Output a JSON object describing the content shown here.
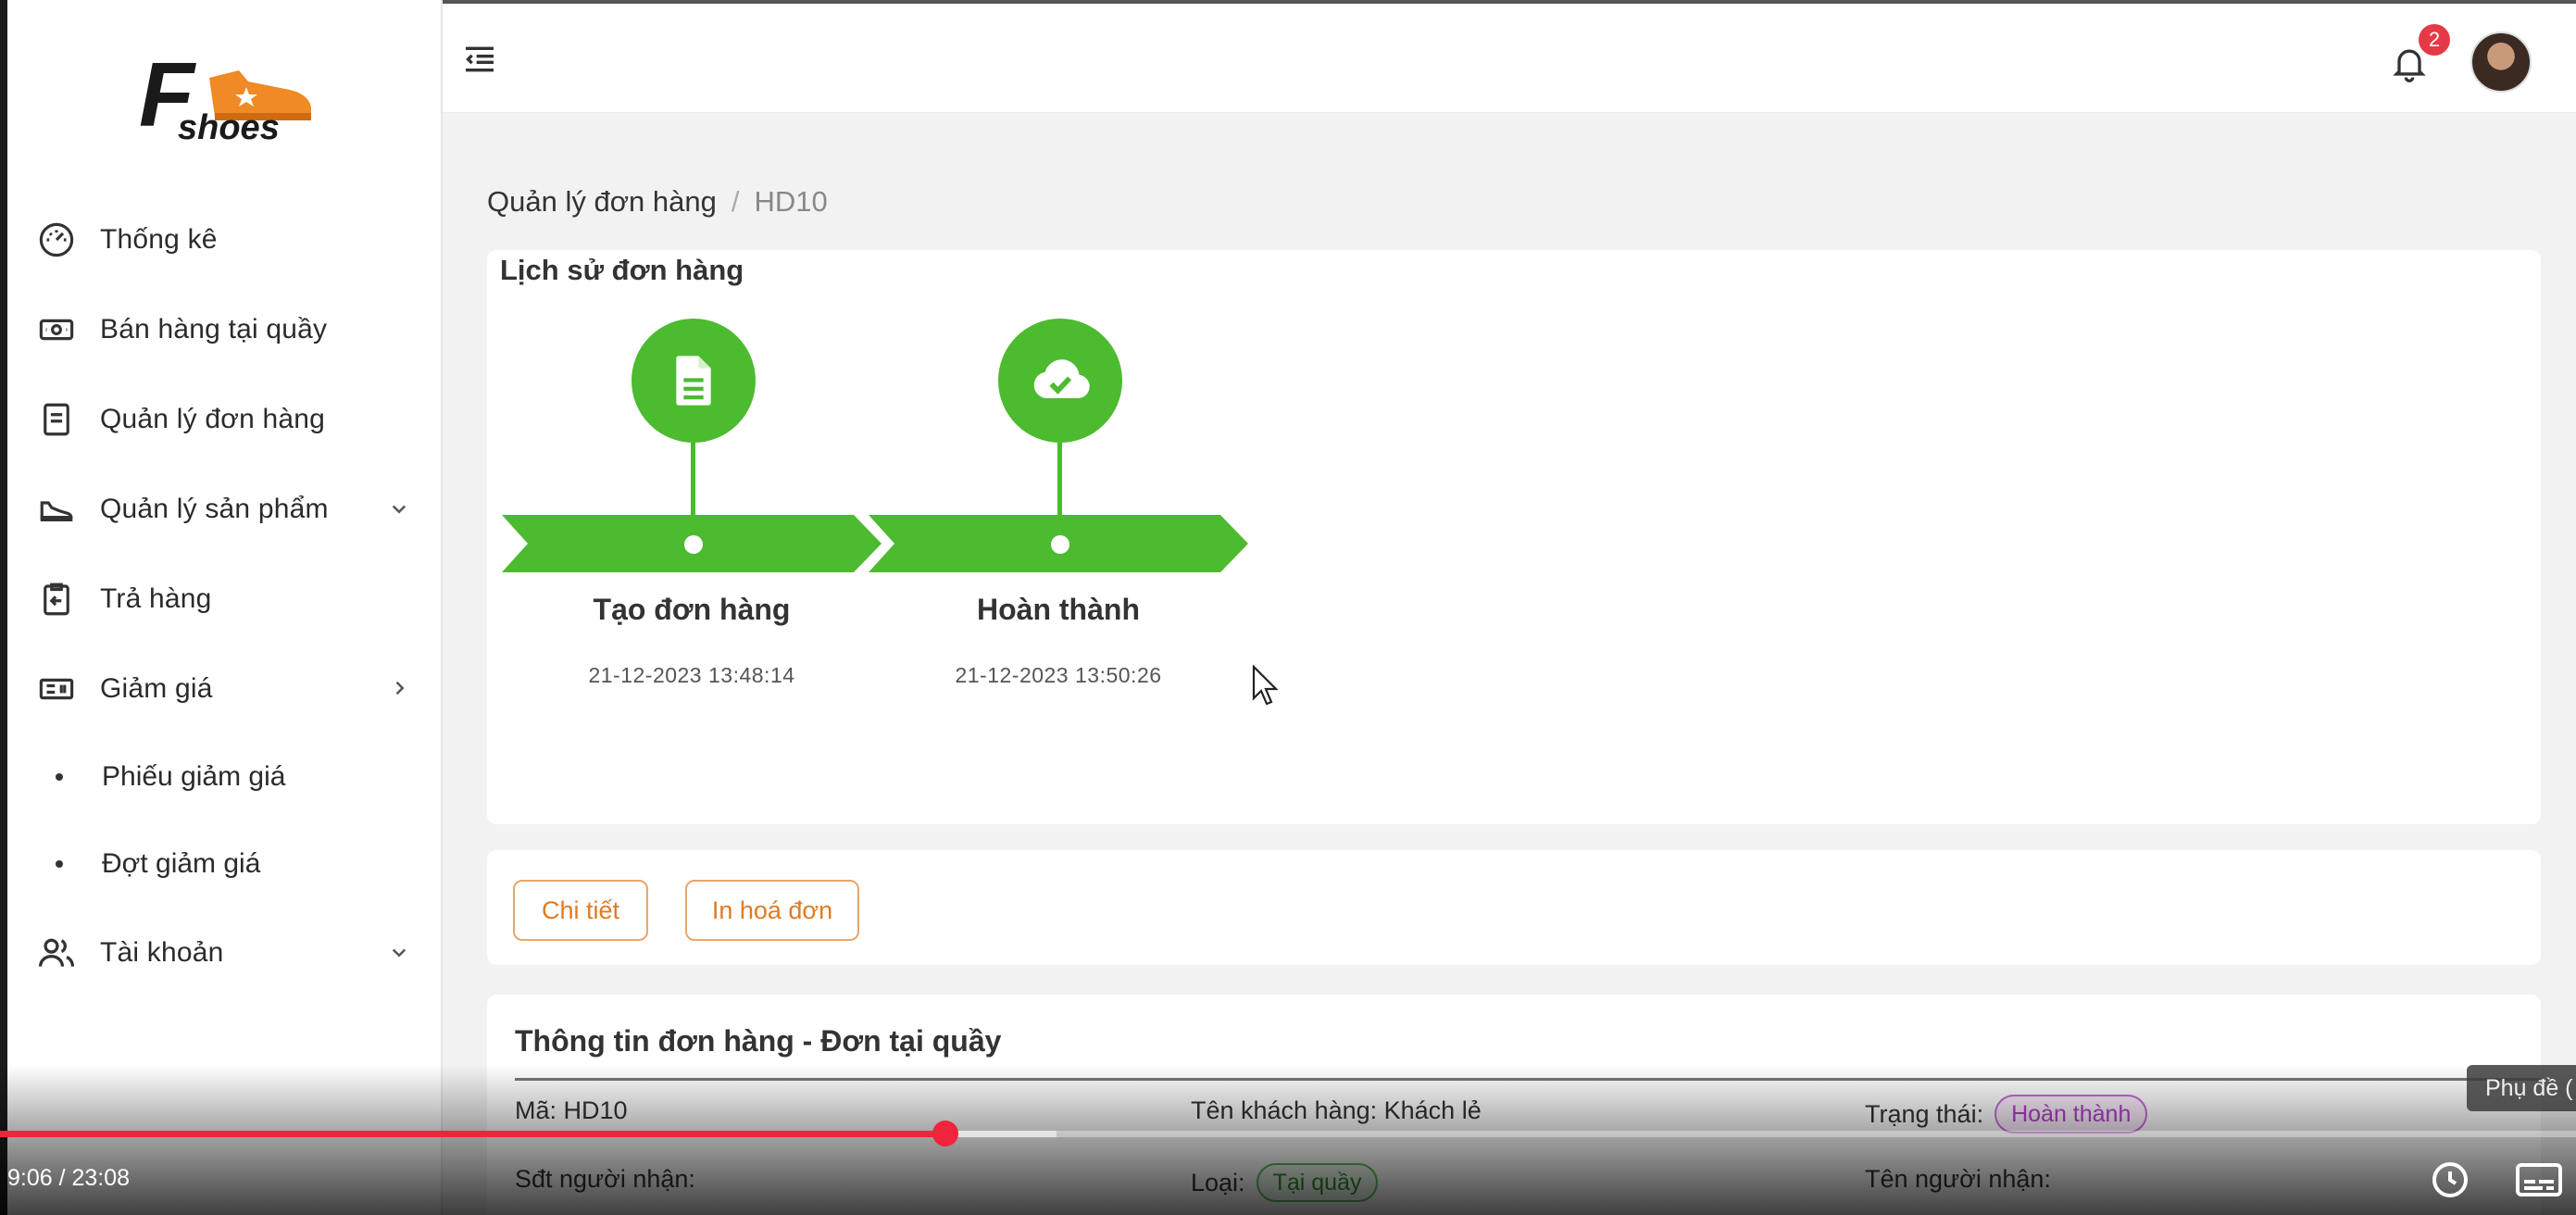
{
  "brand": {
    "logo_text": "F",
    "logo_subtext": "shoes"
  },
  "sidebar": {
    "items": [
      {
        "label": "Thống kê"
      },
      {
        "label": "Bán hàng tại quầy"
      },
      {
        "label": "Quản lý đơn hàng"
      },
      {
        "label": "Quản lý sản phẩm"
      },
      {
        "label": "Trả hàng"
      },
      {
        "label": "Giảm giá"
      },
      {
        "label": "Tài khoản"
      }
    ],
    "sub_items": [
      {
        "label": "Phiếu giảm giá"
      },
      {
        "label": "Đợt giảm giá"
      }
    ]
  },
  "header": {
    "notification_count": "2"
  },
  "breadcrumb": {
    "root": "Quản lý đơn hàng",
    "separator": "/",
    "current": "HD10"
  },
  "history": {
    "title": "Lịch sử đơn hàng",
    "steps": [
      {
        "label": "Tạo đơn hàng",
        "time": "21-12-2023 13:48:14",
        "icon": "document-icon"
      },
      {
        "label": "Hoàn thành",
        "time": "21-12-2023 13:50:26",
        "icon": "cloud-check-icon"
      }
    ],
    "accent_color": "#4cbb2f"
  },
  "actions": {
    "detail_label": "Chi tiết",
    "print_label": "In hoá đơn"
  },
  "order_info": {
    "title": "Thông tin đơn hàng - Đơn tại quầy",
    "code": "Mã: HD10",
    "customer": "Tên khách hàng: Khách lẻ",
    "status_label": "Trạng thái:",
    "status_value": "Hoàn thành",
    "phone_label": "Sđt người nhận:",
    "type_label": "Loại:",
    "type_value": "Tại quầy",
    "receiver_label": "Tên người nhận:"
  },
  "video": {
    "time": "9:06 / 23:08",
    "played_fraction": 0.367,
    "buffered_fraction": 0.41,
    "subtitle_tooltip": "Phụ đề (",
    "progress_color": "#f0243a"
  }
}
